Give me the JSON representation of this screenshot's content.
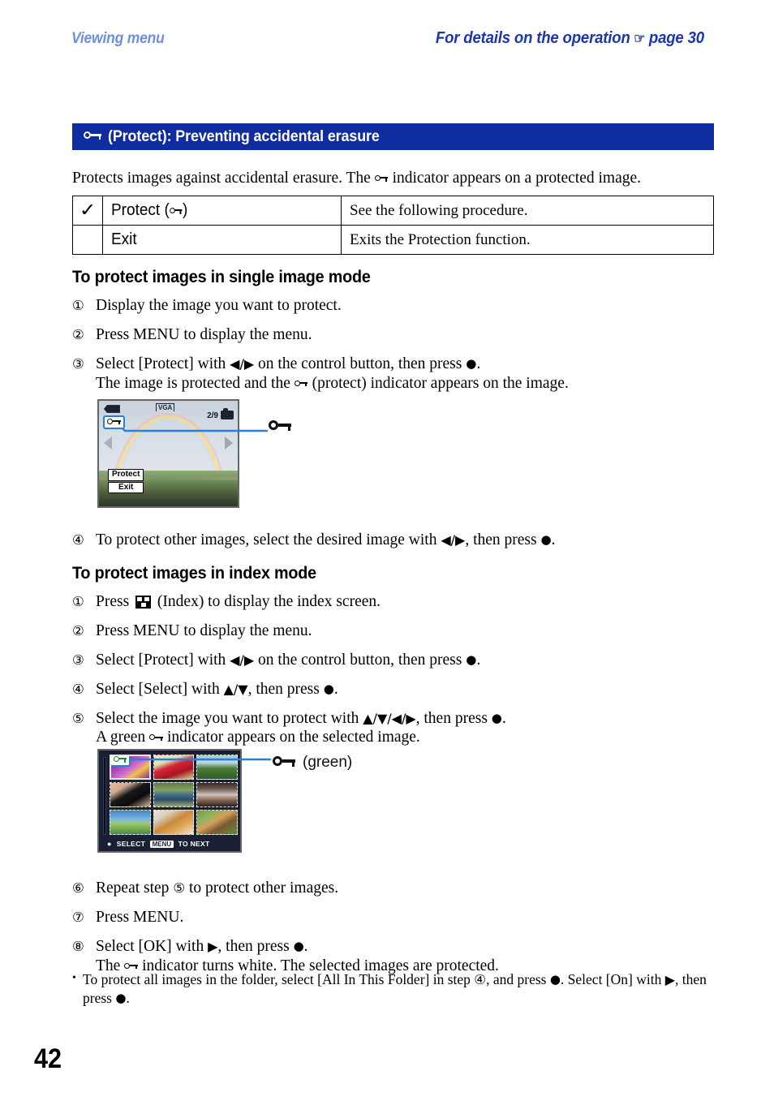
{
  "header": {
    "left_label": "Viewing menu",
    "right_label_pre": "For details on the operation",
    "right_icon": "pointing-hand-icon",
    "right_label_post": "page 30"
  },
  "title_bar": {
    "icon": "protect-key-icon",
    "text": "(Protect): Preventing accidental erasure"
  },
  "intro": {
    "part1": "Protects images against accidental erasure. The",
    "icon": "protect-key-icon",
    "part2": "indicator appears on a protected image."
  },
  "options_table": {
    "rows": [
      {
        "checked": true,
        "check_glyph": "✓",
        "label_pre": "Protect (",
        "label_icon": "protect-key-icon",
        "label_post": ")",
        "description": "See the following procedure."
      },
      {
        "checked": false,
        "check_glyph": "",
        "label_pre": "Exit",
        "label_icon": "",
        "label_post": "",
        "description": "Exits the Protection function."
      }
    ]
  },
  "section_single": {
    "heading": "To protect images in single image mode",
    "steps": [
      {
        "num": "①",
        "text": "Display the image you want to protect."
      },
      {
        "num": "②",
        "text": "Press MENU to display the menu."
      },
      {
        "num": "③",
        "text_a": "Select [Protect] with",
        "arrows": "◀/▶",
        "text_b": "on the control button, then press",
        "button": "●",
        "text_c": ".",
        "sub_a": "The image is protected and the",
        "sub_icon": "protect-key-icon",
        "sub_b": "(protect) indicator appears on the image."
      }
    ],
    "step4": {
      "num": "④",
      "text_a": "To protect other images, select the desired image with",
      "arrows": "◀/▶",
      "text_b": ", then press",
      "button": "●",
      "text_c": "."
    }
  },
  "lcd_single": {
    "battery_icon": "battery-full-icon",
    "quality_label": "VGA",
    "counter": "2/9",
    "folder_icon": "camera-folder-icon",
    "protect_icon": "protect-key-icon",
    "left_arrow": "prev-image-arrow",
    "right_arrow": "next-image-arrow",
    "menu_items": [
      "Protect",
      "Exit"
    ],
    "callout_icon": "protect-key-icon"
  },
  "section_index": {
    "heading": "To protect images in index mode",
    "steps": [
      {
        "num": "①",
        "text_a": "Press",
        "icon": "index-grid-icon",
        "text_b": "(Index) to display the index screen."
      },
      {
        "num": "②",
        "text": "Press MENU to display the menu."
      },
      {
        "num": "③",
        "text_a": "Select [Protect] with",
        "arrows": "◀/▶",
        "text_b": "on the control button, then press",
        "button": "●",
        "text_c": "."
      },
      {
        "num": "④",
        "text_a": "Select [Select] with",
        "arrows": "▲/▼",
        "text_b": ", then press",
        "button": "●",
        "text_c": "."
      },
      {
        "num": "⑤",
        "text_a": "Select the image you want to protect with",
        "arrows": "▲/▼/◀/▶",
        "text_b": ", then press",
        "button": "●",
        "text_c": ".",
        "sub_a": "A green",
        "sub_icon": "protect-key-icon",
        "sub_b": "indicator appears on the selected image."
      }
    ],
    "steps2": [
      {
        "num": "⑥",
        "text_a": "Repeat step",
        "ref": "⑤",
        "text_b": "to protect other images."
      },
      {
        "num": "⑦",
        "text": "Press MENU."
      },
      {
        "num": "⑧",
        "text_a": "Select [OK] with",
        "arrows": "▶",
        "text_b": ", then press",
        "button": "●",
        "text_c": ".",
        "sub_a": "The",
        "sub_icon": "protect-key-icon",
        "sub_b": "indicator turns white. The selected images are protected."
      }
    ],
    "bullet_note": {
      "dot": "•",
      "text_a": "To protect all images in the folder, select [All In This Folder] in step",
      "ref": "④",
      "text_b": ", and press",
      "button1": "●",
      "text_c": ". Select [On] with",
      "arrow": "▶",
      "text_d": ",",
      "text_e": "then press",
      "button2": "●",
      "text_f": "."
    }
  },
  "lcd_index": {
    "protect_icon": "protect-key-icon",
    "protect_icon_color": "#1a8a2e",
    "thumbnails": [
      "purple-flower",
      "red-flower",
      "green-trees",
      "black-cat",
      "child-portrait",
      "winter-trees",
      "green-field",
      "golden-retriever",
      "shiba-dog"
    ],
    "selected_index": 0,
    "bottom_bar": {
      "select_dot": "●",
      "select_label": "SELECT",
      "menu_chip": "MENU",
      "next_label": "TO NEXT"
    },
    "callout_icon": "protect-key-icon",
    "callout_label": "(green)"
  },
  "footer": {
    "page_number": "42"
  },
  "colors": {
    "title_bar_bg": "#0f2d9e",
    "header_left": "#6e8ee0",
    "header_right": "#1b35b5",
    "callout_line": "#2b7fd4",
    "green_protect": "#1a8a2e"
  }
}
